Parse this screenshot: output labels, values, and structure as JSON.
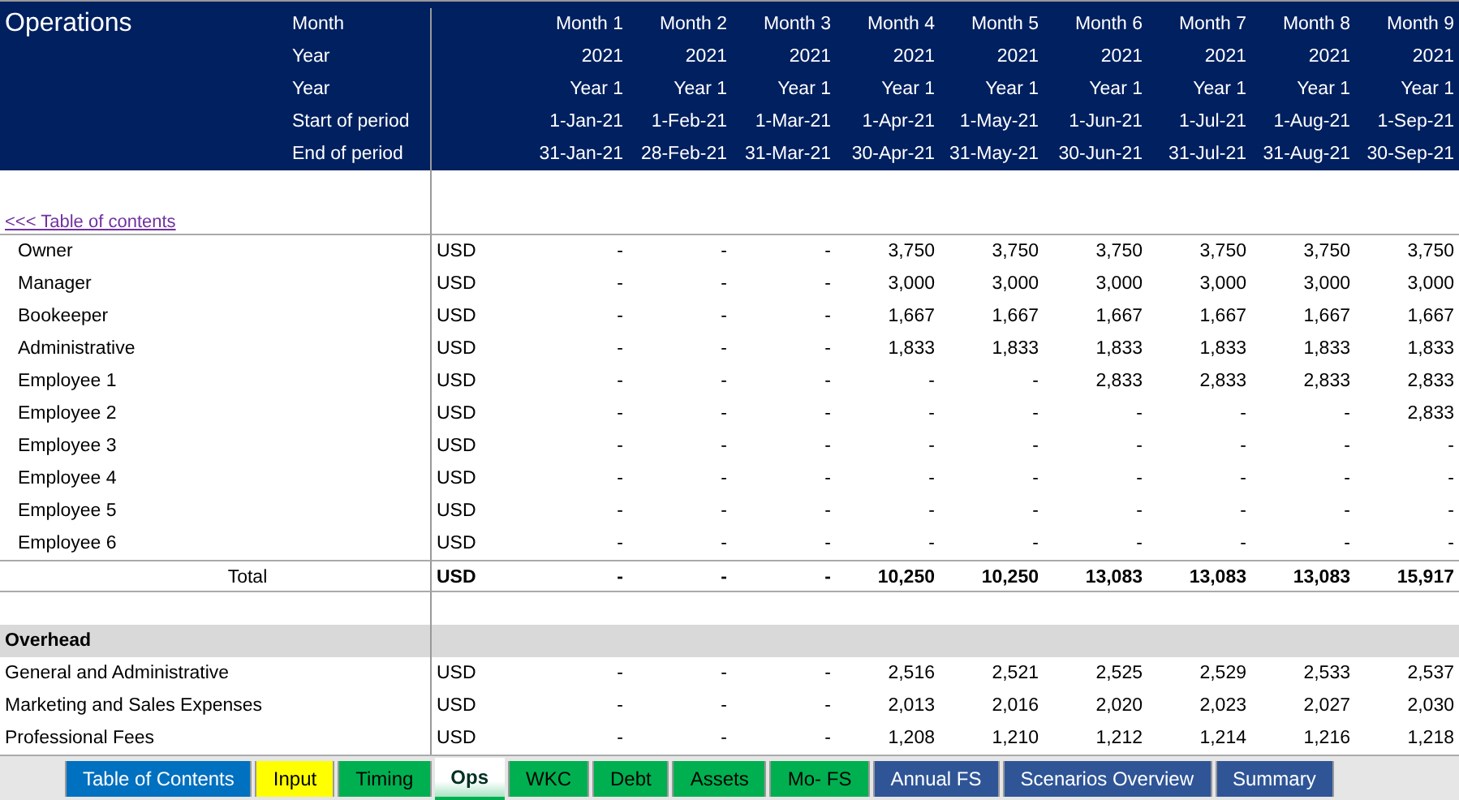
{
  "title": "Operations",
  "header_rows": [
    {
      "label": "Month",
      "values": [
        "Month 1",
        "Month 2",
        "Month 3",
        "Month 4",
        "Month 5",
        "Month 6",
        "Month 7",
        "Month 8",
        "Month 9"
      ]
    },
    {
      "label": "Year",
      "values": [
        "2021",
        "2021",
        "2021",
        "2021",
        "2021",
        "2021",
        "2021",
        "2021",
        "2021"
      ]
    },
    {
      "label": "Year",
      "values": [
        "Year 1",
        "Year 1",
        "Year 1",
        "Year 1",
        "Year 1",
        "Year 1",
        "Year 1",
        "Year 1",
        "Year 1"
      ]
    },
    {
      "label": "Start of period",
      "values": [
        "1-Jan-21",
        "1-Feb-21",
        "1-Mar-21",
        "1-Apr-21",
        "1-May-21",
        "1-Jun-21",
        "1-Jul-21",
        "1-Aug-21",
        "1-Sep-21"
      ]
    },
    {
      "label": "End of period",
      "values": [
        "31-Jan-21",
        "28-Feb-21",
        "31-Mar-21",
        "30-Apr-21",
        "31-May-21",
        "30-Jun-21",
        "31-Jul-21",
        "31-Aug-21",
        "30-Sep-21"
      ]
    }
  ],
  "toc_link": "<<< Table of contents",
  "rows": [
    {
      "kind": "item",
      "label": "Owner",
      "unit": "USD",
      "values": [
        "-",
        "-",
        "-",
        "3,750",
        "3,750",
        "3,750",
        "3,750",
        "3,750",
        "3,750"
      ]
    },
    {
      "kind": "item",
      "label": "Manager",
      "unit": "USD",
      "values": [
        "-",
        "-",
        "-",
        "3,000",
        "3,000",
        "3,000",
        "3,000",
        "3,000",
        "3,000"
      ]
    },
    {
      "kind": "item",
      "label": "Bookeeper",
      "unit": "USD",
      "values": [
        "-",
        "-",
        "-",
        "1,667",
        "1,667",
        "1,667",
        "1,667",
        "1,667",
        "1,667"
      ]
    },
    {
      "kind": "item",
      "label": "Administrative",
      "unit": "USD",
      "values": [
        "-",
        "-",
        "-",
        "1,833",
        "1,833",
        "1,833",
        "1,833",
        "1,833",
        "1,833"
      ]
    },
    {
      "kind": "item",
      "label": "Employee 1",
      "unit": "USD",
      "values": [
        "-",
        "-",
        "-",
        "-",
        "-",
        "2,833",
        "2,833",
        "2,833",
        "2,833"
      ]
    },
    {
      "kind": "item",
      "label": "Employee 2",
      "unit": "USD",
      "values": [
        "-",
        "-",
        "-",
        "-",
        "-",
        "-",
        "-",
        "-",
        "2,833"
      ]
    },
    {
      "kind": "item",
      "label": "Employee 3",
      "unit": "USD",
      "values": [
        "-",
        "-",
        "-",
        "-",
        "-",
        "-",
        "-",
        "-",
        "-"
      ]
    },
    {
      "kind": "item",
      "label": "Employee 4",
      "unit": "USD",
      "values": [
        "-",
        "-",
        "-",
        "-",
        "-",
        "-",
        "-",
        "-",
        "-"
      ]
    },
    {
      "kind": "item",
      "label": "Employee 5",
      "unit": "USD",
      "values": [
        "-",
        "-",
        "-",
        "-",
        "-",
        "-",
        "-",
        "-",
        "-"
      ]
    },
    {
      "kind": "item",
      "label": "Employee 6",
      "unit": "USD",
      "values": [
        "-",
        "-",
        "-",
        "-",
        "-",
        "-",
        "-",
        "-",
        "-"
      ]
    },
    {
      "kind": "total",
      "label": "Total",
      "unit": "USD",
      "values": [
        "-",
        "-",
        "-",
        "10,250",
        "10,250",
        "13,083",
        "13,083",
        "13,083",
        "15,917"
      ]
    },
    {
      "kind": "blank"
    },
    {
      "kind": "section",
      "label": "Overhead"
    },
    {
      "kind": "line",
      "label": "General and Administrative",
      "unit": "USD",
      "values": [
        "-",
        "-",
        "-",
        "2,516",
        "2,521",
        "2,525",
        "2,529",
        "2,533",
        "2,537"
      ]
    },
    {
      "kind": "line",
      "label": "Marketing and Sales Expenses",
      "unit": "USD",
      "values": [
        "-",
        "-",
        "-",
        "2,013",
        "2,016",
        "2,020",
        "2,023",
        "2,027",
        "2,030"
      ]
    },
    {
      "kind": "line",
      "label": "Professional Fees",
      "unit": "USD",
      "values": [
        "-",
        "-",
        "-",
        "1,208",
        "1,210",
        "1,212",
        "1,214",
        "1,216",
        "1,218"
      ]
    }
  ],
  "sheet_tabs": [
    {
      "label": "Table of Contents",
      "color": "#0070c0",
      "selected": false
    },
    {
      "label": "Input",
      "color": "#ffff00",
      "selected": false
    },
    {
      "label": "Timing",
      "color": "#00b050",
      "selected": false
    },
    {
      "label": "Ops",
      "color": "#00b050",
      "selected": true
    },
    {
      "label": "WKC",
      "color": "#00b050",
      "selected": false
    },
    {
      "label": "Debt",
      "color": "#00b050",
      "selected": false
    },
    {
      "label": "Assets",
      "color": "#00b050",
      "selected": false
    },
    {
      "label": "Mo- FS",
      "color": "#00b050",
      "selected": false
    },
    {
      "label": "Annual FS",
      "color": "#2f5597",
      "selected": false
    },
    {
      "label": "Scenarios Overview",
      "color": "#2f5597",
      "selected": false
    },
    {
      "label": "Summary",
      "color": "#2f5597",
      "selected": false
    }
  ]
}
